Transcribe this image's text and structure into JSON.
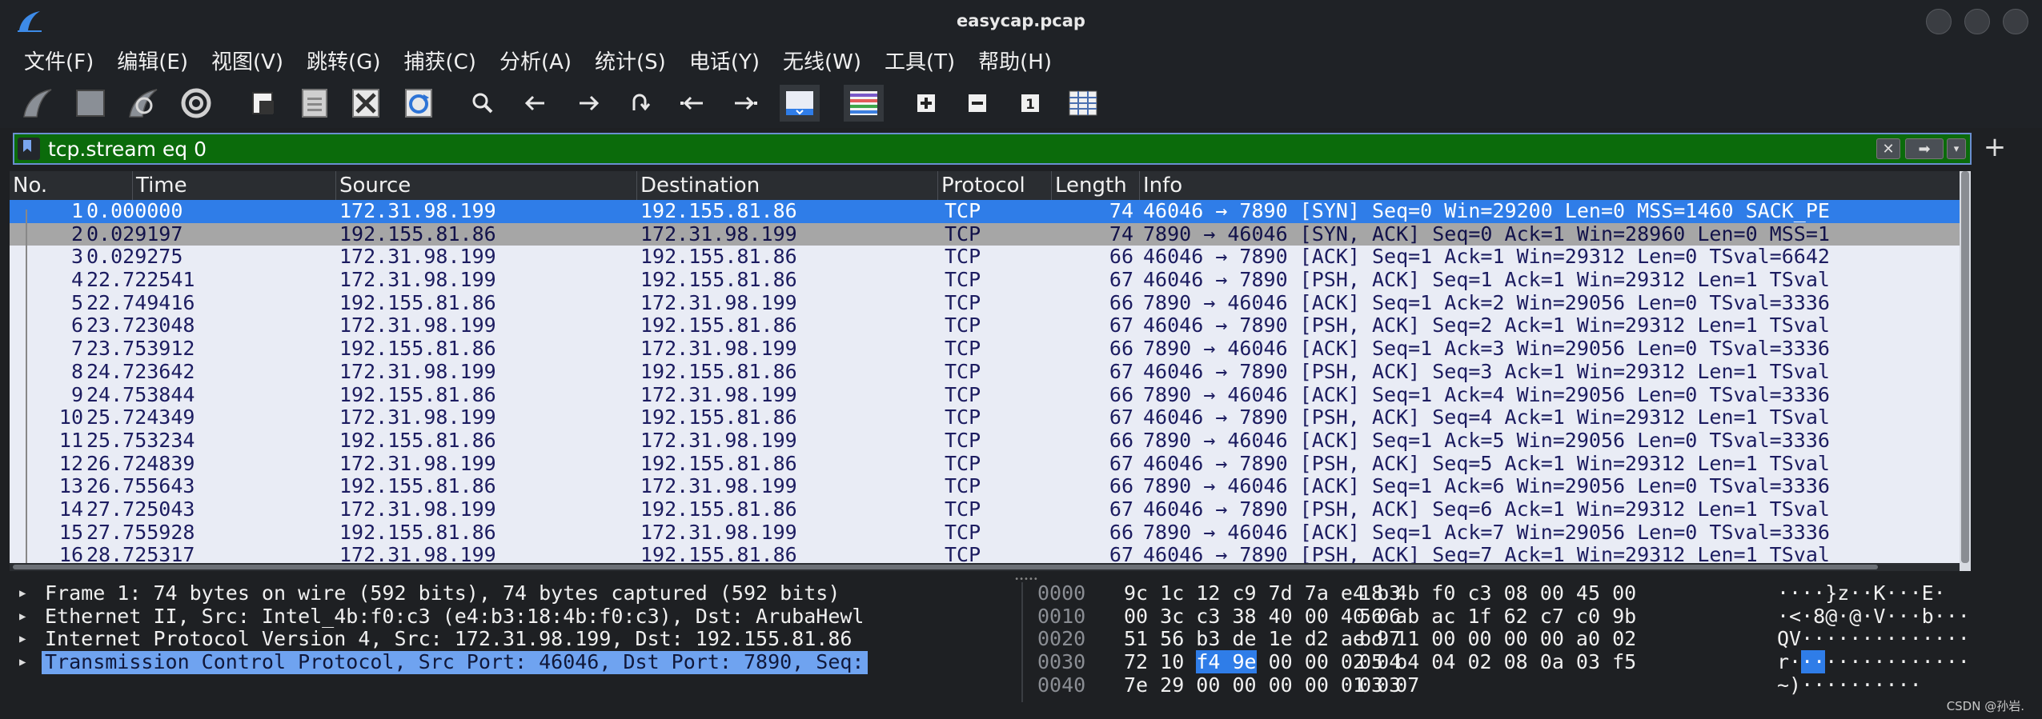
{
  "window": {
    "title": "easycap.pcap"
  },
  "menu": [
    "文件(F)",
    "编辑(E)",
    "视图(V)",
    "跳转(G)",
    "捕获(C)",
    "分析(A)",
    "统计(S)",
    "电话(Y)",
    "无线(W)",
    "工具(T)",
    "帮助(H)"
  ],
  "toolbar": {
    "icons": [
      "start-capture",
      "stop-capture",
      "restart-capture",
      "capture-options",
      "open-file",
      "save-file",
      "close-file",
      "reload-file",
      "find-packet",
      "go-back",
      "go-forward",
      "go-to-packet",
      "first-packet",
      "last-packet",
      "auto-scroll",
      "colorize",
      "zoom-in",
      "zoom-out",
      "normal-size",
      "resize-columns"
    ],
    "zoom_normal_label": "1"
  },
  "filter": {
    "value": "tcp.stream eq 0"
  },
  "columns": [
    "No.",
    "Time",
    "Source",
    "Destination",
    "Protocol",
    "Length",
    "Info"
  ],
  "packets": [
    {
      "no": "1",
      "time": "0.000000",
      "src": "172.31.98.199",
      "dst": "192.155.81.86",
      "proto": "TCP",
      "len": "74",
      "info": "46046 → 7890 [SYN] Seq=0 Win=29200 Len=0 MSS=1460 SACK_PE"
    },
    {
      "no": "2",
      "time": "0.029197",
      "src": "192.155.81.86",
      "dst": "172.31.98.199",
      "proto": "TCP",
      "len": "74",
      "info": "7890 → 46046 [SYN, ACK] Seq=0 Ack=1 Win=28960 Len=0 MSS=1"
    },
    {
      "no": "3",
      "time": "0.029275",
      "src": "172.31.98.199",
      "dst": "192.155.81.86",
      "proto": "TCP",
      "len": "66",
      "info": "46046 → 7890 [ACK] Seq=1 Ack=1 Win=29312 Len=0 TSval=6642"
    },
    {
      "no": "4",
      "time": "22.722541",
      "src": "172.31.98.199",
      "dst": "192.155.81.86",
      "proto": "TCP",
      "len": "67",
      "info": "46046 → 7890 [PSH, ACK] Seq=1 Ack=1 Win=29312 Len=1 TSval"
    },
    {
      "no": "5",
      "time": "22.749416",
      "src": "192.155.81.86",
      "dst": "172.31.98.199",
      "proto": "TCP",
      "len": "66",
      "info": "7890 → 46046 [ACK] Seq=1 Ack=2 Win=29056 Len=0 TSval=3336"
    },
    {
      "no": "6",
      "time": "23.723048",
      "src": "172.31.98.199",
      "dst": "192.155.81.86",
      "proto": "TCP",
      "len": "67",
      "info": "46046 → 7890 [PSH, ACK] Seq=2 Ack=1 Win=29312 Len=1 TSval"
    },
    {
      "no": "7",
      "time": "23.753912",
      "src": "192.155.81.86",
      "dst": "172.31.98.199",
      "proto": "TCP",
      "len": "66",
      "info": "7890 → 46046 [ACK] Seq=1 Ack=3 Win=29056 Len=0 TSval=3336"
    },
    {
      "no": "8",
      "time": "24.723642",
      "src": "172.31.98.199",
      "dst": "192.155.81.86",
      "proto": "TCP",
      "len": "67",
      "info": "46046 → 7890 [PSH, ACK] Seq=3 Ack=1 Win=29312 Len=1 TSval"
    },
    {
      "no": "9",
      "time": "24.753844",
      "src": "192.155.81.86",
      "dst": "172.31.98.199",
      "proto": "TCP",
      "len": "66",
      "info": "7890 → 46046 [ACK] Seq=1 Ack=4 Win=29056 Len=0 TSval=3336"
    },
    {
      "no": "10",
      "time": "25.724349",
      "src": "172.31.98.199",
      "dst": "192.155.81.86",
      "proto": "TCP",
      "len": "67",
      "info": "46046 → 7890 [PSH, ACK] Seq=4 Ack=1 Win=29312 Len=1 TSval"
    },
    {
      "no": "11",
      "time": "25.753234",
      "src": "192.155.81.86",
      "dst": "172.31.98.199",
      "proto": "TCP",
      "len": "66",
      "info": "7890 → 46046 [ACK] Seq=1 Ack=5 Win=29056 Len=0 TSval=3336"
    },
    {
      "no": "12",
      "time": "26.724839",
      "src": "172.31.98.199",
      "dst": "192.155.81.86",
      "proto": "TCP",
      "len": "67",
      "info": "46046 → 7890 [PSH, ACK] Seq=5 Ack=1 Win=29312 Len=1 TSval"
    },
    {
      "no": "13",
      "time": "26.755643",
      "src": "192.155.81.86",
      "dst": "172.31.98.199",
      "proto": "TCP",
      "len": "66",
      "info": "7890 → 46046 [ACK] Seq=1 Ack=6 Win=29056 Len=0 TSval=3336"
    },
    {
      "no": "14",
      "time": "27.725043",
      "src": "172.31.98.199",
      "dst": "192.155.81.86",
      "proto": "TCP",
      "len": "67",
      "info": "46046 → 7890 [PSH, ACK] Seq=6 Ack=1 Win=29312 Len=1 TSval"
    },
    {
      "no": "15",
      "time": "27.755928",
      "src": "192.155.81.86",
      "dst": "172.31.98.199",
      "proto": "TCP",
      "len": "66",
      "info": "7890 → 46046 [ACK] Seq=1 Ack=7 Win=29056 Len=0 TSval=3336"
    },
    {
      "no": "16",
      "time": "28.725317",
      "src": "172.31.98.199",
      "dst": "192.155.81.86",
      "proto": "TCP",
      "len": "67",
      "info": "46046 → 7890 [PSH, ACK] Seq=7 Ack=1 Win=29312 Len=1 TSval"
    }
  ],
  "selected_packet": "1",
  "details": [
    "Frame 1: 74 bytes on wire (592 bits), 74 bytes captured (592 bits)",
    "Ethernet II, Src: Intel_4b:f0:c3 (e4:b3:18:4b:f0:c3), Dst: ArubaHewl",
    "Internet Protocol Version 4, Src: 172.31.98.199, Dst: 192.155.81.86",
    "Transmission Control Protocol, Src Port: 46046, Dst Port: 7890, Seq:"
  ],
  "bytes": [
    {
      "offset": "0000",
      "hex1": "9c 1c 12 c9 7d 7a e4 b3",
      "hex2": "18 4b f0 c3 08 00 45 00",
      "ascii": "····}z··K···E·"
    },
    {
      "offset": "0010",
      "hex1": "00 3c c3 38 40 00 40 06",
      "hex2": "56 ab ac 1f 62 c7 c0 9b",
      "ascii": "·<·8@·@·V···b···"
    },
    {
      "offset": "0020",
      "hex1": "51 56 b3 de 1e d2 ae 97",
      "hex2": "bd 11 00 00 00 00 a0 02",
      "ascii": "QV··············"
    },
    {
      "offset": "0030",
      "hex1_pre": "72 10 ",
      "hex1_hl": "f4 9e",
      "hex1_post": " 00 00 02 04",
      "hex2": "05 b4 04 02 08 0a 03 f5",
      "ascii_pre": "r·",
      "ascii_hl": "··",
      "ascii_post": "············"
    },
    {
      "offset": "0040",
      "hex1": "7e 29 00 00 00 00 01 03",
      "hex2": "03 07",
      "ascii": "~)··········"
    }
  ],
  "watermark": "CSDN @孙岩.",
  "colors": {
    "filter_bg": "#0b6b0b",
    "selected_row": "#2f7de8",
    "alt_row": "#a6a6a6",
    "list_bg": "#e9ecf5"
  }
}
